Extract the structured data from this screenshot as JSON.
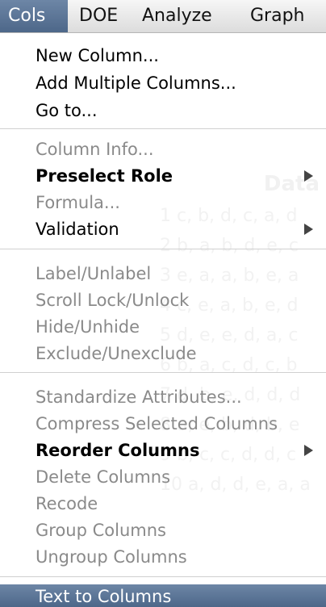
{
  "menubar": {
    "items": [
      {
        "label": "Cols",
        "active": true
      },
      {
        "label": "DOE",
        "active": false
      },
      {
        "label": "Analyze",
        "active": false
      },
      {
        "label": "Graph",
        "active": false
      }
    ]
  },
  "background": {
    "heading": "Data",
    "rows": [
      "1 c, b, d, c, a, d",
      "2 b, a, b, d, e, c",
      "3 e, a, a, b, e, a",
      "4 c, e, a, b, e, d",
      "5 d, e, e, d, a, c",
      "6 b, a, c, d, c, b",
      "7 d, b, e, d, d, d",
      "8 a, e, b, d, b, e",
      "9 b, c, c, d, d, c",
      "10 a, d, d, e, a, a"
    ]
  },
  "menu": {
    "group1": [
      "New Column...",
      "Add Multiple Columns...",
      "Go to..."
    ],
    "group2": [
      {
        "label": "Column Info...",
        "enabled": false,
        "submenu": false
      },
      {
        "label": "Preselect Role",
        "enabled": true,
        "submenu": true
      },
      {
        "label": "Formula...",
        "enabled": false,
        "submenu": false
      },
      {
        "label": "Validation",
        "enabled": true,
        "submenu": true
      }
    ],
    "group3": [
      "Label/Unlabel",
      "Scroll Lock/Unlock",
      "Hide/Unhide",
      "Exclude/Unexclude"
    ],
    "group4": [
      {
        "label": "Standardize Attributes...",
        "enabled": false,
        "submenu": false
      },
      {
        "label": "Compress Selected Columns",
        "enabled": false,
        "submenu": false
      },
      {
        "label": "Reorder Columns",
        "enabled": true,
        "submenu": true
      },
      {
        "label": "Delete Columns",
        "enabled": false,
        "submenu": false
      },
      {
        "label": "Recode",
        "enabled": false,
        "submenu": false
      },
      {
        "label": "Group Columns",
        "enabled": false,
        "submenu": false
      },
      {
        "label": "Ungroup Columns",
        "enabled": false,
        "submenu": false
      }
    ],
    "highlighted_item": "Text to Columns"
  },
  "colors": {
    "highlight": "#5a7495",
    "disabled_text": "#8a8a8a"
  }
}
